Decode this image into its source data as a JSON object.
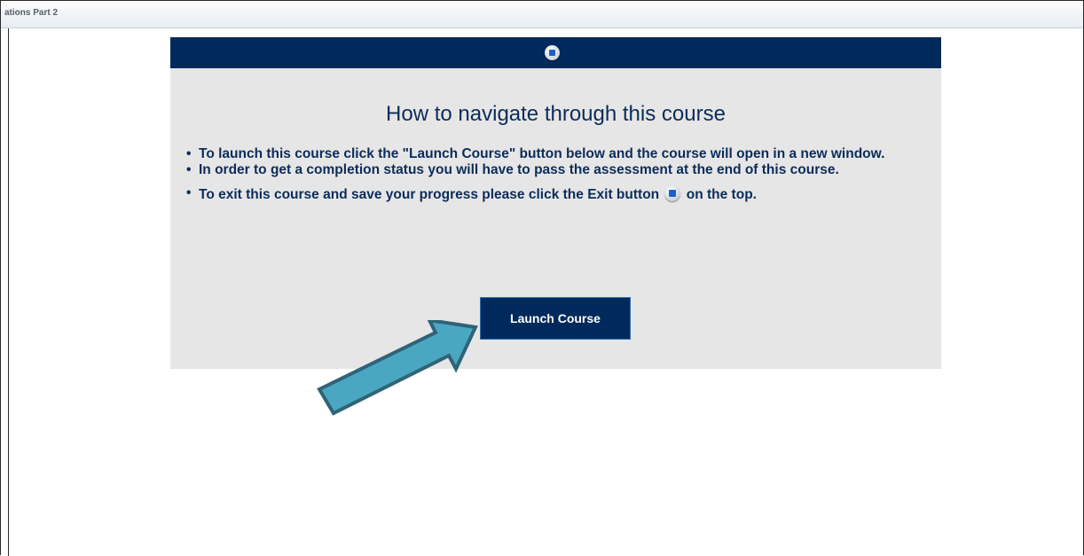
{
  "window": {
    "title": "ations Part 2"
  },
  "course": {
    "exit_icon": "exit-button-icon",
    "heading": "How to navigate through this course",
    "instructions": {
      "item1": "To launch this course click the \"Launch Course\" button below and the course will open in a new window.",
      "item2": "In order to get a completion status you will have to pass the assessment at the end of this course.",
      "item3_before": "To exit this course and save your progress please click the ",
      "item3_exit_word": "Exit",
      "item3_after_word": " button",
      "item3_end": " on the top."
    },
    "launch_label": "Launch Course"
  },
  "annotation": {
    "arrow_icon": "arrow-pointer-icon",
    "arrow_color": "#4aa7c2"
  },
  "colors": {
    "header_navy": "#002a5c",
    "panel_gray": "#e6e6e6",
    "text_navy": "#0b2c5a"
  }
}
